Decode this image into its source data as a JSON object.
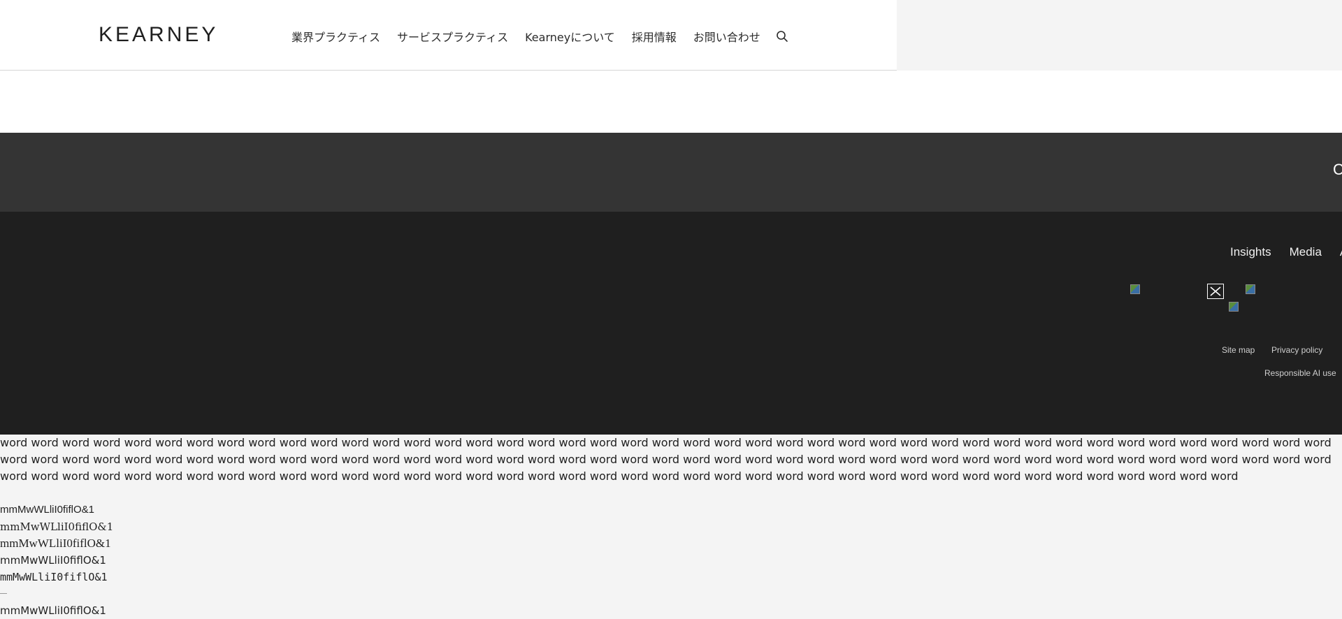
{
  "header": {
    "logo": "KEARNEY",
    "nav": [
      "業界プラクティス",
      "サービスプラクティス",
      "Kearneyについて",
      "採用情報",
      "お問い合わせ"
    ],
    "search_icon": "search-icon"
  },
  "band": {
    "glyph": "C"
  },
  "footer": {
    "links": [
      "Insights",
      "Media",
      "A"
    ],
    "legal": [
      "Site map",
      "Privacy policy",
      "Responsible AI use"
    ],
    "social_icons": [
      "broken-image-icon",
      "x-icon",
      "broken-image-icon",
      "broken-image-icon"
    ]
  },
  "content": {
    "words": "word word word word word word word word word word word word word word word word word word word word word word word word word word word word word word word word word word word word word word word word word word word word word word word word word word word word word word word word word word word word word word word word word word word word word word word word word word word word word word word word word word word word word word word word word word word word word word word word word word word word word word word word word word word word word word word word word word word word word word word word word word word word word word",
    "samples": [
      "mmMwWLliI0fiflO&1",
      "mmMwWLliI0fiflO&1",
      "mmMwWLliI0fiflO&1",
      "mmMwWLliI0fiflO&1",
      "mmMwWLliI0fiflO&1",
      "mmMwWLliI0fiflO&1"
    ]
  }
}
